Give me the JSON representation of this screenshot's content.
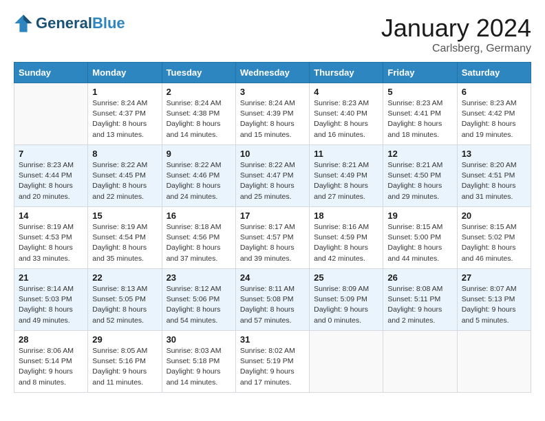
{
  "logo": {
    "text_general": "General",
    "text_blue": "Blue"
  },
  "header": {
    "month": "January 2024",
    "location": "Carlsberg, Germany"
  },
  "days_of_week": [
    "Sunday",
    "Monday",
    "Tuesday",
    "Wednesday",
    "Thursday",
    "Friday",
    "Saturday"
  ],
  "weeks": [
    [
      {
        "day": "",
        "sunrise": "",
        "sunset": "",
        "daylight": ""
      },
      {
        "day": "1",
        "sunrise": "Sunrise: 8:24 AM",
        "sunset": "Sunset: 4:37 PM",
        "daylight": "Daylight: 8 hours and 13 minutes."
      },
      {
        "day": "2",
        "sunrise": "Sunrise: 8:24 AM",
        "sunset": "Sunset: 4:38 PM",
        "daylight": "Daylight: 8 hours and 14 minutes."
      },
      {
        "day": "3",
        "sunrise": "Sunrise: 8:24 AM",
        "sunset": "Sunset: 4:39 PM",
        "daylight": "Daylight: 8 hours and 15 minutes."
      },
      {
        "day": "4",
        "sunrise": "Sunrise: 8:23 AM",
        "sunset": "Sunset: 4:40 PM",
        "daylight": "Daylight: 8 hours and 16 minutes."
      },
      {
        "day": "5",
        "sunrise": "Sunrise: 8:23 AM",
        "sunset": "Sunset: 4:41 PM",
        "daylight": "Daylight: 8 hours and 18 minutes."
      },
      {
        "day": "6",
        "sunrise": "Sunrise: 8:23 AM",
        "sunset": "Sunset: 4:42 PM",
        "daylight": "Daylight: 8 hours and 19 minutes."
      }
    ],
    [
      {
        "day": "7",
        "sunrise": "Sunrise: 8:23 AM",
        "sunset": "Sunset: 4:44 PM",
        "daylight": "Daylight: 8 hours and 20 minutes."
      },
      {
        "day": "8",
        "sunrise": "Sunrise: 8:22 AM",
        "sunset": "Sunset: 4:45 PM",
        "daylight": "Daylight: 8 hours and 22 minutes."
      },
      {
        "day": "9",
        "sunrise": "Sunrise: 8:22 AM",
        "sunset": "Sunset: 4:46 PM",
        "daylight": "Daylight: 8 hours and 24 minutes."
      },
      {
        "day": "10",
        "sunrise": "Sunrise: 8:22 AM",
        "sunset": "Sunset: 4:47 PM",
        "daylight": "Daylight: 8 hours and 25 minutes."
      },
      {
        "day": "11",
        "sunrise": "Sunrise: 8:21 AM",
        "sunset": "Sunset: 4:49 PM",
        "daylight": "Daylight: 8 hours and 27 minutes."
      },
      {
        "day": "12",
        "sunrise": "Sunrise: 8:21 AM",
        "sunset": "Sunset: 4:50 PM",
        "daylight": "Daylight: 8 hours and 29 minutes."
      },
      {
        "day": "13",
        "sunrise": "Sunrise: 8:20 AM",
        "sunset": "Sunset: 4:51 PM",
        "daylight": "Daylight: 8 hours and 31 minutes."
      }
    ],
    [
      {
        "day": "14",
        "sunrise": "Sunrise: 8:19 AM",
        "sunset": "Sunset: 4:53 PM",
        "daylight": "Daylight: 8 hours and 33 minutes."
      },
      {
        "day": "15",
        "sunrise": "Sunrise: 8:19 AM",
        "sunset": "Sunset: 4:54 PM",
        "daylight": "Daylight: 8 hours and 35 minutes."
      },
      {
        "day": "16",
        "sunrise": "Sunrise: 8:18 AM",
        "sunset": "Sunset: 4:56 PM",
        "daylight": "Daylight: 8 hours and 37 minutes."
      },
      {
        "day": "17",
        "sunrise": "Sunrise: 8:17 AM",
        "sunset": "Sunset: 4:57 PM",
        "daylight": "Daylight: 8 hours and 39 minutes."
      },
      {
        "day": "18",
        "sunrise": "Sunrise: 8:16 AM",
        "sunset": "Sunset: 4:59 PM",
        "daylight": "Daylight: 8 hours and 42 minutes."
      },
      {
        "day": "19",
        "sunrise": "Sunrise: 8:15 AM",
        "sunset": "Sunset: 5:00 PM",
        "daylight": "Daylight: 8 hours and 44 minutes."
      },
      {
        "day": "20",
        "sunrise": "Sunrise: 8:15 AM",
        "sunset": "Sunset: 5:02 PM",
        "daylight": "Daylight: 8 hours and 46 minutes."
      }
    ],
    [
      {
        "day": "21",
        "sunrise": "Sunrise: 8:14 AM",
        "sunset": "Sunset: 5:03 PM",
        "daylight": "Daylight: 8 hours and 49 minutes."
      },
      {
        "day": "22",
        "sunrise": "Sunrise: 8:13 AM",
        "sunset": "Sunset: 5:05 PM",
        "daylight": "Daylight: 8 hours and 52 minutes."
      },
      {
        "day": "23",
        "sunrise": "Sunrise: 8:12 AM",
        "sunset": "Sunset: 5:06 PM",
        "daylight": "Daylight: 8 hours and 54 minutes."
      },
      {
        "day": "24",
        "sunrise": "Sunrise: 8:11 AM",
        "sunset": "Sunset: 5:08 PM",
        "daylight": "Daylight: 8 hours and 57 minutes."
      },
      {
        "day": "25",
        "sunrise": "Sunrise: 8:09 AM",
        "sunset": "Sunset: 5:09 PM",
        "daylight": "Daylight: 9 hours and 0 minutes."
      },
      {
        "day": "26",
        "sunrise": "Sunrise: 8:08 AM",
        "sunset": "Sunset: 5:11 PM",
        "daylight": "Daylight: 9 hours and 2 minutes."
      },
      {
        "day": "27",
        "sunrise": "Sunrise: 8:07 AM",
        "sunset": "Sunset: 5:13 PM",
        "daylight": "Daylight: 9 hours and 5 minutes."
      }
    ],
    [
      {
        "day": "28",
        "sunrise": "Sunrise: 8:06 AM",
        "sunset": "Sunset: 5:14 PM",
        "daylight": "Daylight: 9 hours and 8 minutes."
      },
      {
        "day": "29",
        "sunrise": "Sunrise: 8:05 AM",
        "sunset": "Sunset: 5:16 PM",
        "daylight": "Daylight: 9 hours and 11 minutes."
      },
      {
        "day": "30",
        "sunrise": "Sunrise: 8:03 AM",
        "sunset": "Sunset: 5:18 PM",
        "daylight": "Daylight: 9 hours and 14 minutes."
      },
      {
        "day": "31",
        "sunrise": "Sunrise: 8:02 AM",
        "sunset": "Sunset: 5:19 PM",
        "daylight": "Daylight: 9 hours and 17 minutes."
      },
      {
        "day": "",
        "sunrise": "",
        "sunset": "",
        "daylight": ""
      },
      {
        "day": "",
        "sunrise": "",
        "sunset": "",
        "daylight": ""
      },
      {
        "day": "",
        "sunrise": "",
        "sunset": "",
        "daylight": ""
      }
    ]
  ]
}
